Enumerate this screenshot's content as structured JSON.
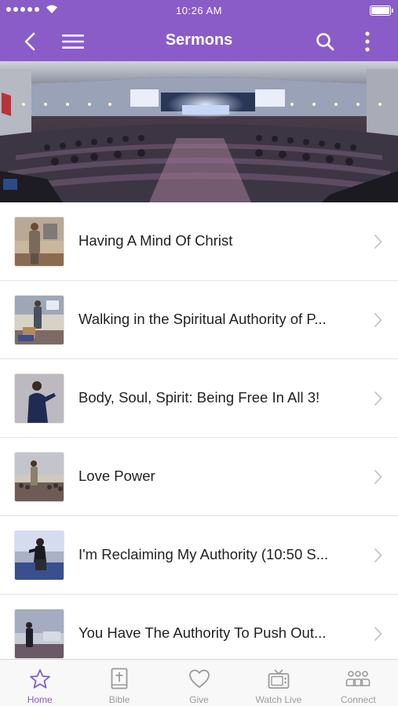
{
  "status_bar": {
    "time": "10:26 AM"
  },
  "nav": {
    "title": "Sermons"
  },
  "colors": {
    "brand": "#8a5cc8",
    "tab_inactive": "#9b9b9b"
  },
  "sermons": [
    {
      "title": "Having A Mind Of Christ"
    },
    {
      "title": "Walking in the Spiritual Authority of P..."
    },
    {
      "title": "Body, Soul, Spirit: Being Free In All 3!"
    },
    {
      "title": "Love Power"
    },
    {
      "title": "I'm Reclaiming My Authority (10:50 S..."
    },
    {
      "title": "You Have The Authority To Push Out..."
    }
  ],
  "tabs": [
    {
      "label": "Home",
      "icon": "star-icon",
      "active": true
    },
    {
      "label": "Bible",
      "icon": "bible-icon",
      "active": false
    },
    {
      "label": "Give",
      "icon": "heart-icon",
      "active": false
    },
    {
      "label": "Watch Live",
      "icon": "tv-icon",
      "active": false
    },
    {
      "label": "Connect",
      "icon": "people-icon",
      "active": false
    }
  ]
}
